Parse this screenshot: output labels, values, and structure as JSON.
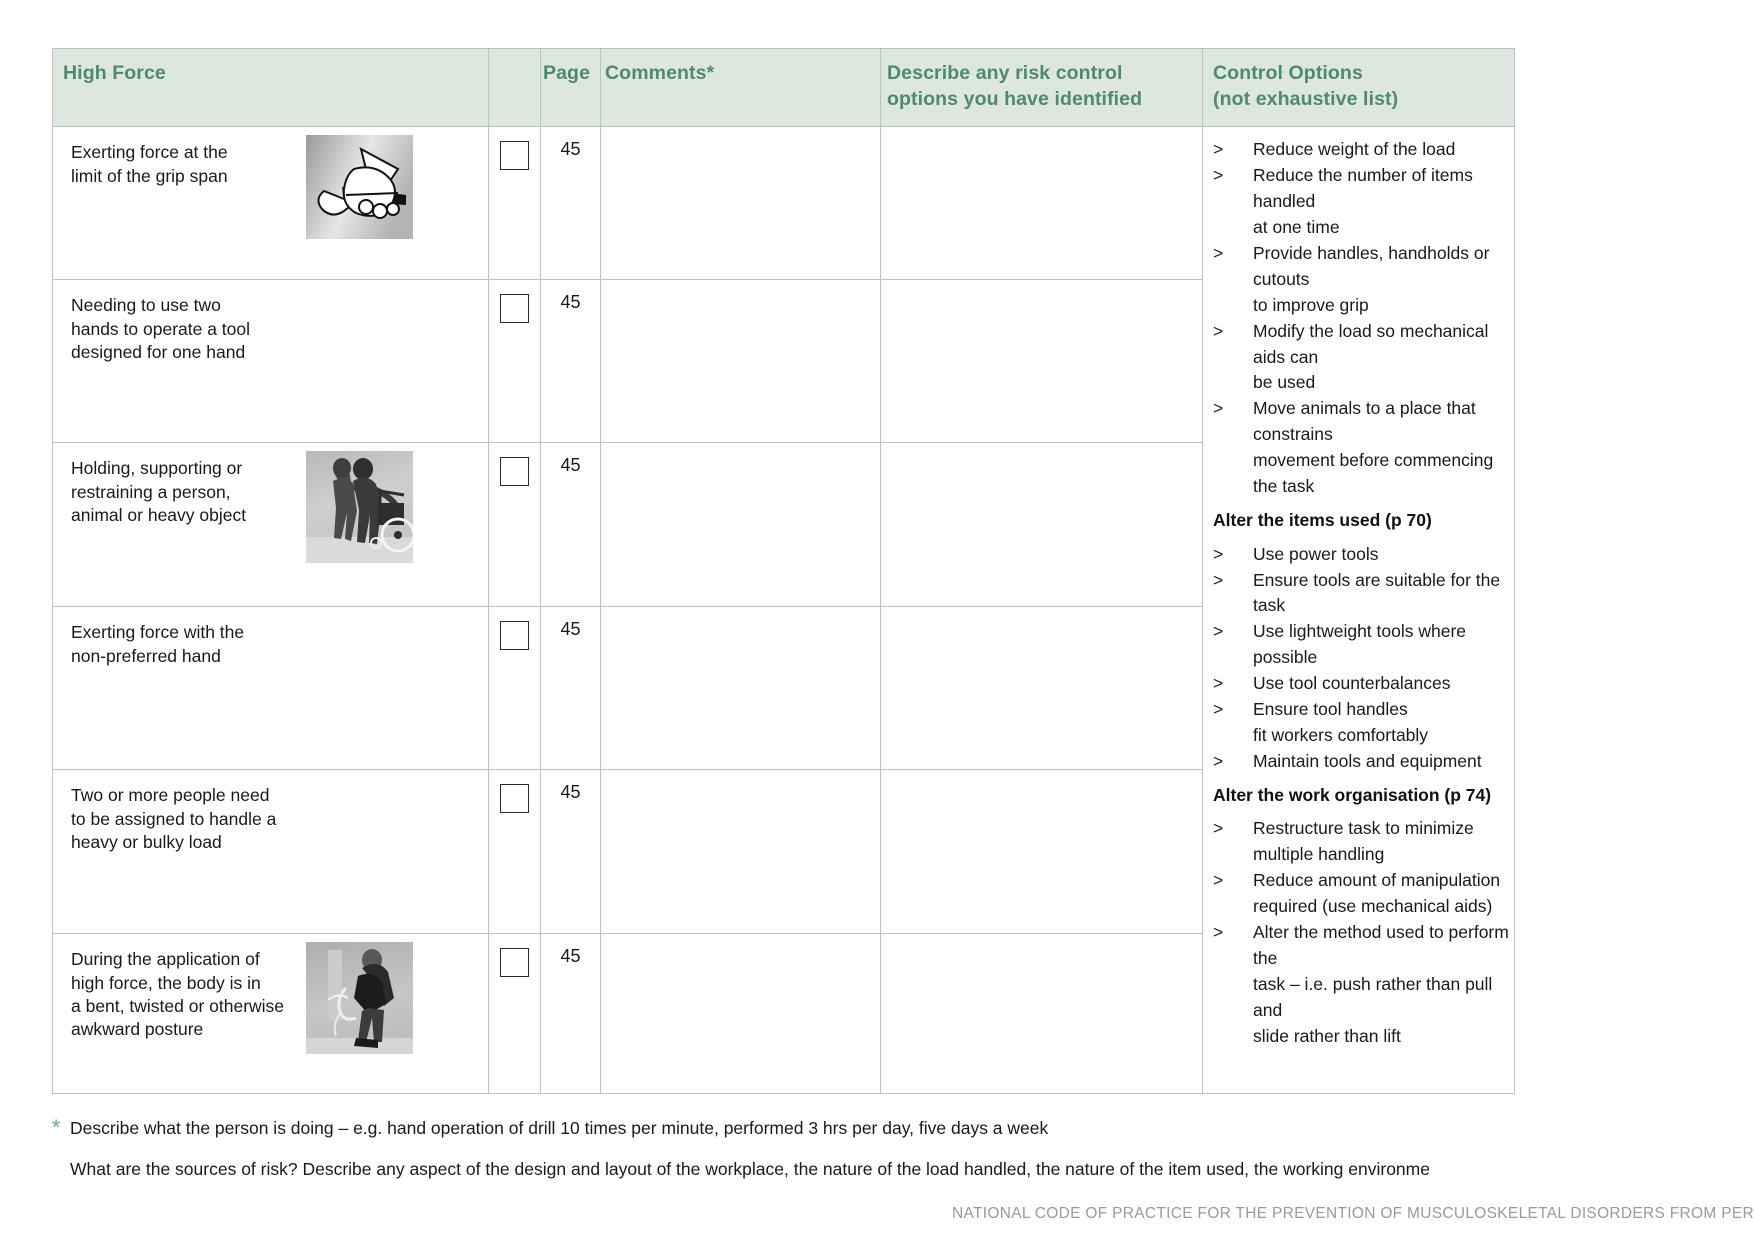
{
  "table": {
    "headers": {
      "hazard": "High Force",
      "checkbox": "",
      "page": "Page",
      "comments": "Comments*",
      "describe_line1": "Describe any risk control",
      "describe_line2": "options you have identified",
      "control_line1": "Control Options",
      "control_line2": "(not exhaustive list)"
    },
    "rows": [
      {
        "hazard": "Exerting force at the\nlimit of the grip span",
        "page": "45",
        "image": "hand-gripping-pliers-illustration",
        "comments": "",
        "describe": ""
      },
      {
        "hazard": "Needing to use two\nhands to operate a tool\ndesigned for one hand",
        "page": "45",
        "image": "",
        "comments": "",
        "describe": ""
      },
      {
        "hazard": "Holding, supporting or\nrestraining a person,\nanimal or heavy object",
        "page": "45",
        "image": "carer-assisting-person-wheelchair-photo",
        "comments": "",
        "describe": ""
      },
      {
        "hazard": "Exerting force with the\nnon-preferred hand",
        "page": "45",
        "image": "",
        "comments": "",
        "describe": ""
      },
      {
        "hazard": "Two or more people need\nto be assigned to handle a\nheavy or bulky load",
        "page": "45",
        "image": "",
        "comments": "",
        "describe": ""
      },
      {
        "hazard": "During the application of\n high force, the body is in\na bent, twisted or otherwise\nawkward posture",
        "page": "45",
        "image": "worker-bent-posture-photo",
        "comments": "",
        "describe": ""
      }
    ]
  },
  "control_options": {
    "bullet_marker": ">",
    "group1": {
      "items": [
        "Reduce weight of the load",
        "Reduce the number of items handled\nat one time",
        "Provide handles, handholds or cutouts\nto improve grip",
        "Modify the load so mechanical aids can\nbe used",
        "Move animals to a place that constrains\nmovement before commencing the task"
      ]
    },
    "group2": {
      "heading": "Alter the items used (p 70)",
      "items": [
        "Use power tools",
        "Ensure tools are suitable for the task",
        "Use lightweight tools where possible",
        "Use tool counterbalances",
        "Ensure tool handles\nfit workers comfortably",
        "Maintain tools and equipment"
      ]
    },
    "group3": {
      "heading": "Alter the work organisation (p 74)",
      "items": [
        "Restructure task to minimize\nmultiple handling",
        "Reduce amount of manipulation\nrequired (use mechanical aids)",
        "Alter the method used to perform the\ntask – i.e. push rather than pull and\nslide rather than lift"
      ]
    }
  },
  "footnotes": {
    "marker": "*",
    "line1": "Describe what the person is doing – e.g. hand operation of drill 10 times per minute, performed 3 hrs per day, five days a week",
    "line2": "What are the sources of risk? Describe any aspect of the design and layout of the workplace, the nature of the load handled, the nature of the item used, the working environme"
  },
  "footer": {
    "text": "NATIONAL CODE OF PRACTICE FOR THE PREVENTION OF MUSCULOSKELETAL DISORDERS FROM PER"
  },
  "colors": {
    "header_bg": "#dde6df",
    "header_text": "#4e8a72",
    "border": "#b9c3bd",
    "body_text": "#1a1a1a",
    "footer_text": "#9a9a9a"
  }
}
